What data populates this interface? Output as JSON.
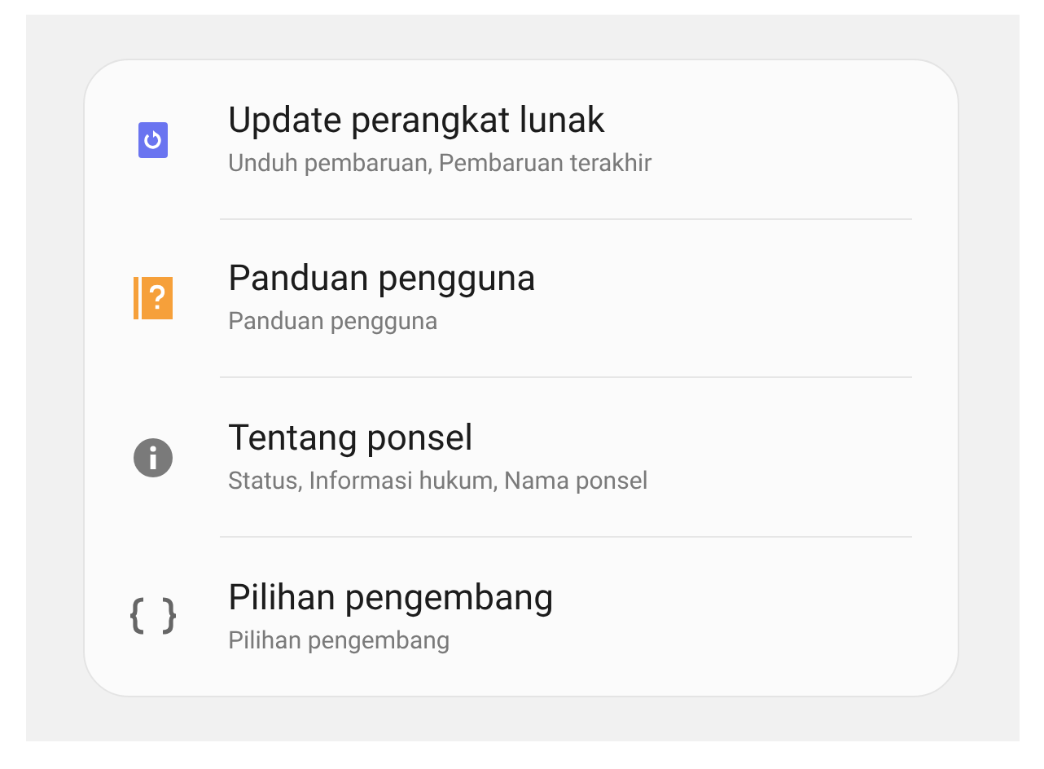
{
  "settings": [
    {
      "title": "Update perangkat lunak",
      "subtitle": "Unduh pembaruan, Pembaruan terakhir"
    },
    {
      "title": "Panduan pengguna",
      "subtitle": "Panduan pengguna"
    },
    {
      "title": "Tentang ponsel",
      "subtitle": "Status, Informasi hukum, Nama ponsel"
    },
    {
      "title": "Pilihan pengembang",
      "subtitle": "Pilihan pengembang"
    }
  ]
}
